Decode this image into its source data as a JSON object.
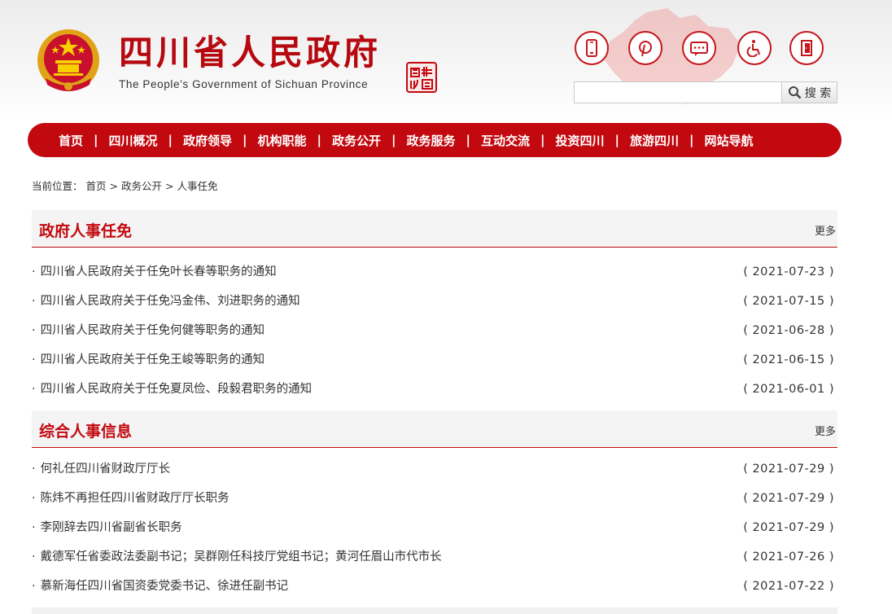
{
  "header": {
    "title": "四川省人民政府",
    "subtitle": "The People’s Government of Sichuan Province",
    "tool_icons": [
      "mobile-icon",
      "weibo-icon",
      "message-icon",
      "accessibility-icon",
      "exit-door-icon"
    ],
    "accent_color": "#c2090f"
  },
  "search": {
    "value": "",
    "placeholder": "",
    "button_label": "搜 索"
  },
  "nav": {
    "items": [
      "首页",
      "四川概况",
      "政府领导",
      "机构职能",
      "政务公开",
      "政务服务",
      "互动交流",
      "投资四川",
      "旅游四川",
      "网站导航"
    ]
  },
  "breadcrumb": {
    "prefix": "当前位置：",
    "items": [
      "首页",
      "政务公开",
      "人事任免"
    ],
    "separator": ">"
  },
  "sections": [
    {
      "title": "政府人事任免",
      "more": "更多",
      "items": [
        {
          "title": "四川省人民政府关于任免叶长春等职务的通知",
          "date": "( 2021-07-23 )"
        },
        {
          "title": "四川省人民政府关于任免冯金伟、刘进职务的通知",
          "date": "( 2021-07-15 )"
        },
        {
          "title": "四川省人民政府关于任免何健等职务的通知",
          "date": "( 2021-06-28 )"
        },
        {
          "title": "四川省人民政府关于任免王峻等职务的通知",
          "date": "( 2021-06-15 )"
        },
        {
          "title": "四川省人民政府关于任免夏凤俭、段毅君职务的通知",
          "date": "( 2021-06-01 )"
        }
      ]
    },
    {
      "title": "综合人事信息",
      "more": "更多",
      "items": [
        {
          "title": "何礼任四川省财政厅厅长",
          "date": "( 2021-07-29 )"
        },
        {
          "title": "陈炜不再担任四川省财政厅厅长职务",
          "date": "( 2021-07-29 )"
        },
        {
          "title": "李刚辞去四川省副省长职务",
          "date": "( 2021-07-29 )"
        },
        {
          "title": "戴德军任省委政法委副书记；吴群刚任科技厅党组书记；黄河任眉山市代市长",
          "date": "( 2021-07-26 )"
        },
        {
          "title": "慕新海任四川省国资委党委书记、徐进任副书记",
          "date": "( 2021-07-22 )"
        }
      ]
    }
  ]
}
